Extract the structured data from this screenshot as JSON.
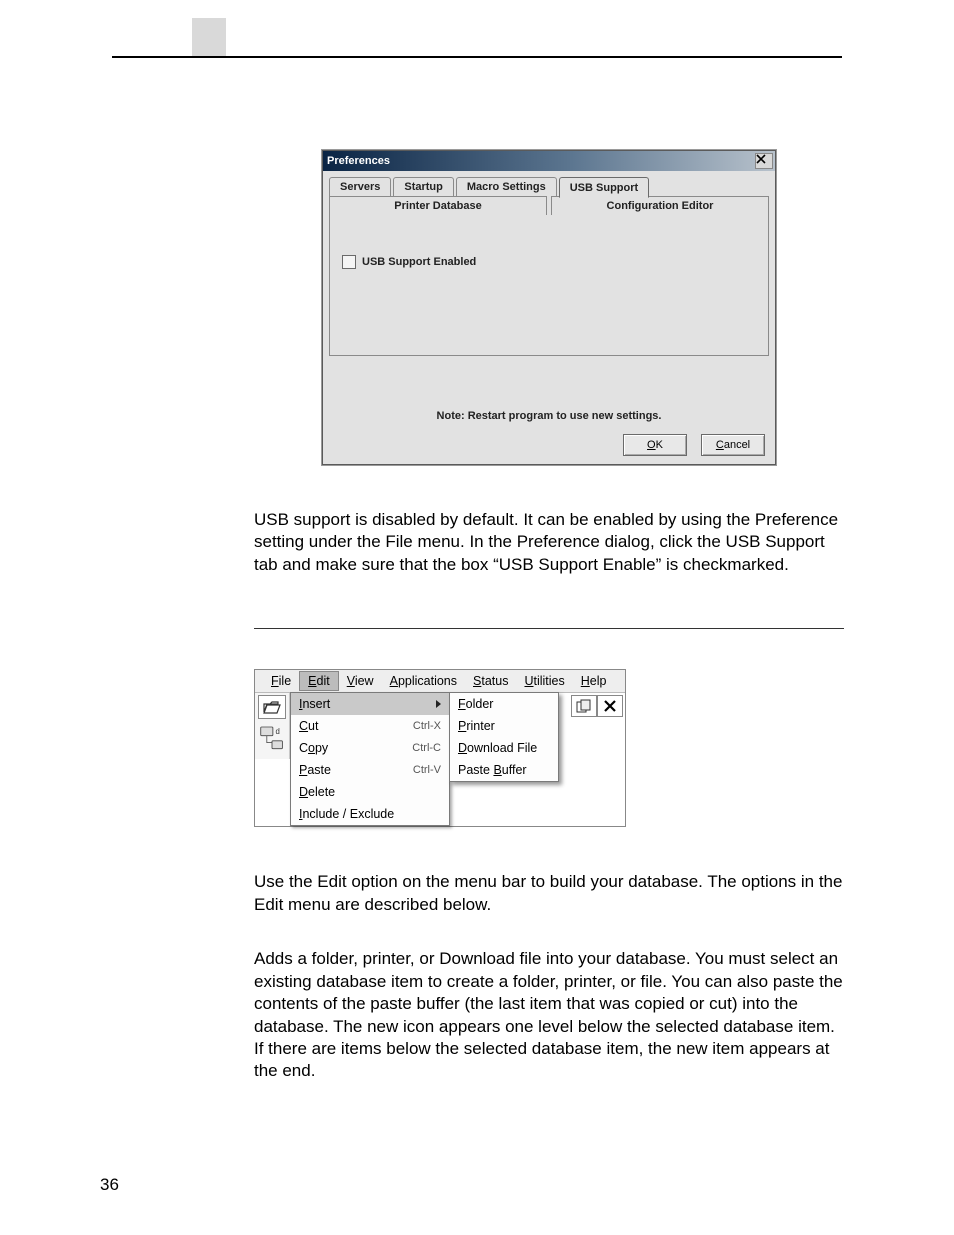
{
  "page_number": "36",
  "dialog": {
    "title": "Preferences",
    "tabs_row1": [
      "Servers",
      "Startup",
      "Macro Settings",
      "USB Support"
    ],
    "tabs_row1_active_index": 3,
    "tabs_row2": [
      "Printer Database",
      "Configuration Editor"
    ],
    "checkbox_label": "USB Support Enabled",
    "note": "Note: Restart program to use new settings.",
    "ok_u": "O",
    "ok_rest": "K",
    "cancel_u": "C",
    "cancel_rest": "ancel"
  },
  "para1": "USB support is disabled by default. It can be enabled by using the Preference setting under the File menu. In the Preference dialog, click the USB Support tab and make sure that the box “USB Support Enable” is checkmarked.",
  "menubar": {
    "items": [
      {
        "u": "F",
        "rest": "ile"
      },
      {
        "u": "E",
        "rest": "dit"
      },
      {
        "u": "V",
        "rest": "iew"
      },
      {
        "u": "A",
        "rest": "pplications"
      },
      {
        "u": "S",
        "rest": "tatus"
      },
      {
        "u": "U",
        "rest": "tilities"
      },
      {
        "u": "H",
        "rest": "elp"
      }
    ],
    "open_index": 1
  },
  "edit_menu": {
    "items": [
      {
        "label_u": "I",
        "label_rest": "nsert",
        "shortcut": "",
        "has_sub": true,
        "hover": true
      },
      {
        "label_u": "C",
        "label_rest": "ut",
        "shortcut": "Ctrl-X"
      },
      {
        "label_pre": "C",
        "label_u": "o",
        "label_rest": "py",
        "shortcut": "Ctrl-C"
      },
      {
        "label_u": "P",
        "label_rest": "aste",
        "shortcut": "Ctrl-V"
      },
      {
        "label_u": "D",
        "label_rest": "elete",
        "shortcut": ""
      },
      {
        "label_u": "I",
        "label_rest": "nclude / Exclude",
        "shortcut": ""
      }
    ]
  },
  "insert_submenu": {
    "items": [
      {
        "u": "F",
        "rest": "older"
      },
      {
        "u": "P",
        "rest": "rinter"
      },
      {
        "u": "D",
        "rest": "ownload File"
      },
      {
        "pre": "Paste ",
        "u": "B",
        "rest": "uffer"
      }
    ]
  },
  "icons": {
    "toolbar_left": [
      "open-folder-icon",
      "printer-icon",
      "network-printer-icon"
    ],
    "toolbar_right": [
      "copy-icon",
      "delete-x-icon"
    ]
  },
  "para2": "Use the Edit option on the menu bar to build your database. The options in the Edit menu are described below.",
  "para3": "Adds a folder, printer, or Download file into your database. You must select an existing database item to create a folder, printer, or file. You can also paste the contents of the paste buffer (the last item that was copied or cut) into the database. The new icon appears one level below the selected database item. If there are items below the selected database item, the new item appears at the end."
}
